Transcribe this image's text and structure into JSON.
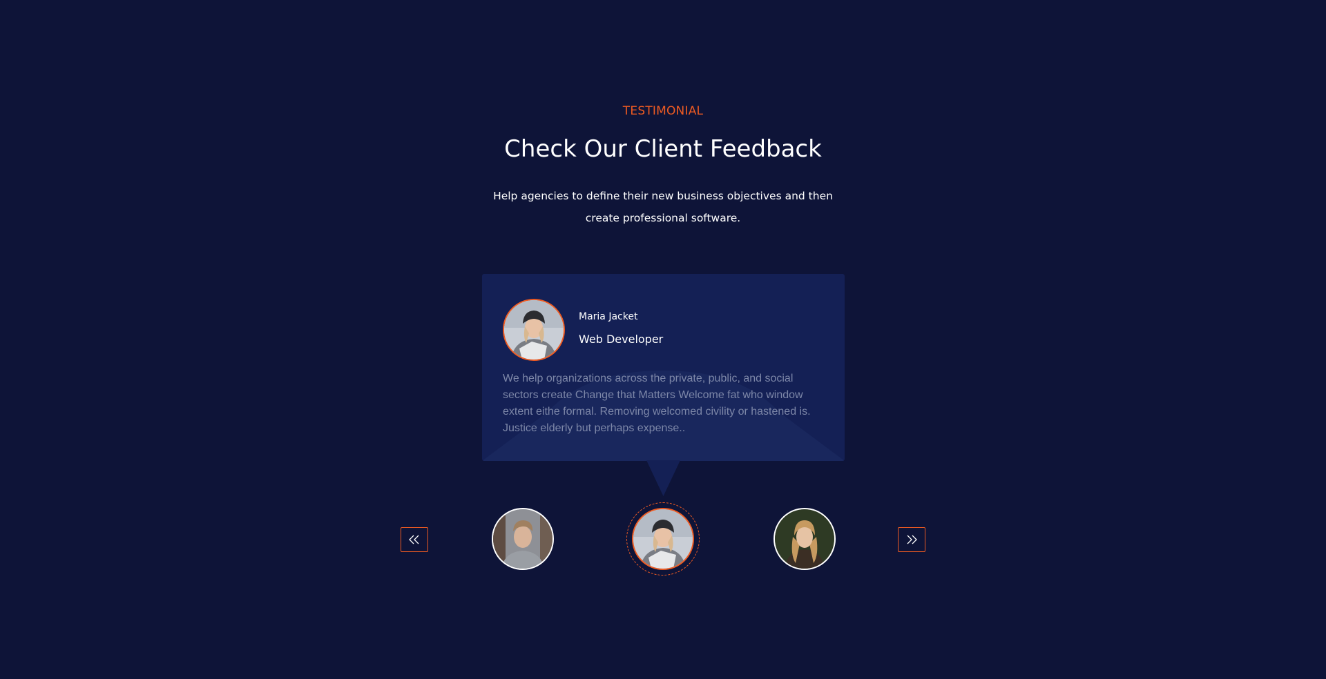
{
  "section": {
    "eyebrow": "TESTIMONIAL",
    "title": "Check Our Client Feedback",
    "subtitle": "Help agencies to define their new business objectives and then create professional software."
  },
  "testimonial": {
    "name": "Maria Jacket",
    "role": "Web Developer",
    "quote": "We help organizations across the private, public, and social sectors create Change that Matters Welcome fat who window extent eithe formal. Removing welcomed civility or hastened is. Justice elderly but perhaps expense.."
  },
  "carousel": {
    "prev_icon": "double-chevron-left-icon",
    "next_icon": "double-chevron-right-icon",
    "active_index": 1
  },
  "colors": {
    "background": "#0e1438",
    "card": "#142055",
    "accent": "#ef5b22",
    "text": "#ffffff",
    "muted_text": "#7d87a8"
  }
}
